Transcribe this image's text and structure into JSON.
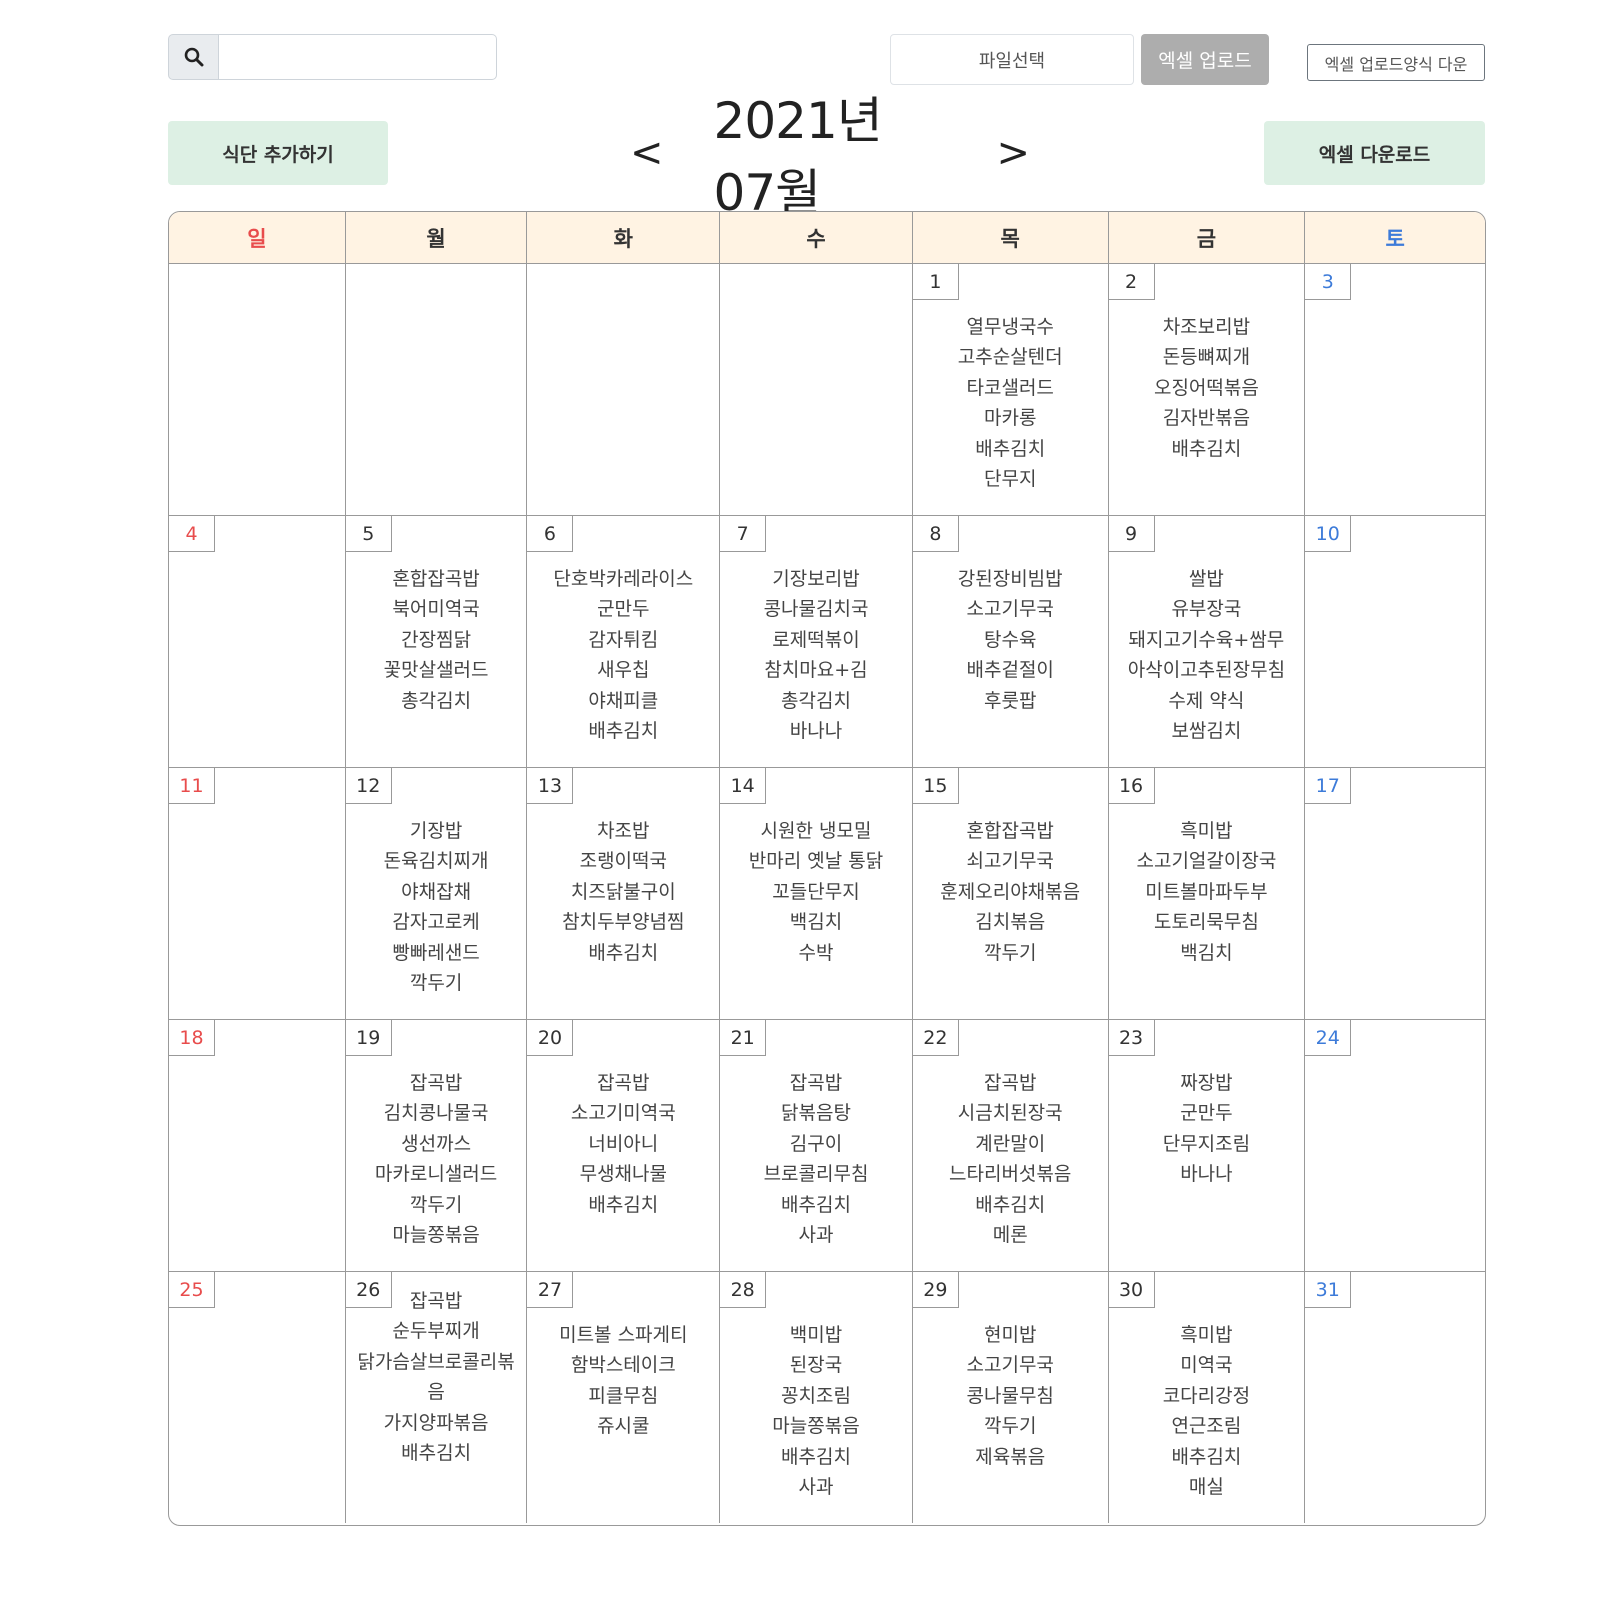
{
  "toolbar": {
    "search": {
      "icon": "search-icon",
      "value": "",
      "placeholder": ""
    },
    "file_select_label": "파일선택",
    "upload_label": "엑셀 업로드",
    "template_label": "엑셀 업로드양식 다운"
  },
  "header": {
    "add_meal_label": "식단 추가하기",
    "prev_label": "<",
    "month_title": "2021년 07월",
    "next_label": ">",
    "excel_download_label": "엑셀 다운로드"
  },
  "colors": {
    "header_bg": "#fff3e3",
    "button_bg": "#ddf0e4",
    "sunday": "#e84c4c",
    "saturday": "#3d7bd9",
    "upload_bg": "#adadad"
  },
  "weekdays": [
    "일",
    "월",
    "화",
    "수",
    "목",
    "금",
    "토"
  ],
  "weeks": [
    [
      {
        "day": "",
        "menu": []
      },
      {
        "day": "",
        "menu": []
      },
      {
        "day": "",
        "menu": []
      },
      {
        "day": "",
        "menu": []
      },
      {
        "day": "1",
        "menu": [
          "열무냉국수",
          "고추순살텐더",
          "타코샐러드",
          "마카롱",
          "배추김치",
          "단무지"
        ]
      },
      {
        "day": "2",
        "menu": [
          "차조보리밥",
          "돈등뼈찌개",
          "오징어떡볶음",
          "김자반볶음",
          "배추김치"
        ]
      },
      {
        "day": "3",
        "menu": []
      }
    ],
    [
      {
        "day": "4",
        "menu": []
      },
      {
        "day": "5",
        "menu": [
          "혼합잡곡밥",
          "북어미역국",
          "간장찜닭",
          "꽃맛살샐러드",
          "총각김치"
        ]
      },
      {
        "day": "6",
        "menu": [
          "단호박카레라이스",
          "군만두",
          "감자튀킴",
          "새우칩",
          "야채피클",
          "배추김치"
        ]
      },
      {
        "day": "7",
        "menu": [
          "기장보리밥",
          "콩나물김치국",
          "로제떡볶이",
          "참치마요+김",
          "총각김치",
          "바나나"
        ]
      },
      {
        "day": "8",
        "menu": [
          "강된장비빔밥",
          "소고기무국",
          "탕수육",
          "배추겉절이",
          "후룻팝"
        ]
      },
      {
        "day": "9",
        "menu": [
          "쌀밥",
          "유부장국",
          "돼지고기수육+쌈무",
          "아삭이고추된장무침",
          "수제 약식",
          "보쌈김치"
        ]
      },
      {
        "day": "10",
        "menu": []
      }
    ],
    [
      {
        "day": "11",
        "menu": []
      },
      {
        "day": "12",
        "menu": [
          "기장밥",
          "돈육김치찌개",
          "야채잡채",
          "감자고로케",
          "빵빠레샌드",
          "깍두기"
        ]
      },
      {
        "day": "13",
        "menu": [
          "차조밥",
          "조랭이떡국",
          "치즈닭불구이",
          "참치두부양념찜",
          "배추김치"
        ]
      },
      {
        "day": "14",
        "menu": [
          "시원한 냉모밀",
          "반마리 옛날 통닭",
          "꼬들단무지",
          "백김치",
          "수박"
        ]
      },
      {
        "day": "15",
        "menu": [
          "혼합잡곡밥",
          "쇠고기무국",
          "훈제오리야채볶음",
          "김치볶음",
          "깍두기"
        ]
      },
      {
        "day": "16",
        "menu": [
          "흑미밥",
          "소고기얼갈이장국",
          "미트볼마파두부",
          "도토리묵무침",
          "백김치"
        ]
      },
      {
        "day": "17",
        "menu": []
      }
    ],
    [
      {
        "day": "18",
        "menu": []
      },
      {
        "day": "19",
        "menu": [
          "잡곡밥",
          "김치콩나물국",
          "생선까스",
          "마카로니샐러드",
          "깍두기",
          "마늘쫑볶음"
        ]
      },
      {
        "day": "20",
        "menu": [
          "잡곡밥",
          "소고기미역국",
          "너비아니",
          "무생채나물",
          "배추김치"
        ]
      },
      {
        "day": "21",
        "menu": [
          "잡곡밥",
          "닭볶음탕",
          "김구이",
          "브로콜리무침",
          "배추김치",
          "사과"
        ]
      },
      {
        "day": "22",
        "menu": [
          "잡곡밥",
          "시금치된장국",
          "계란말이",
          "느타리버섯볶음",
          "배추김치",
          "메론"
        ]
      },
      {
        "day": "23",
        "menu": [
          "짜장밥",
          "군만두",
          "단무지조림",
          "바나나"
        ]
      },
      {
        "day": "24",
        "menu": []
      }
    ],
    [
      {
        "day": "25",
        "menu": []
      },
      {
        "day": "26",
        "menu": [
          "잡곡밥",
          "순두부찌개",
          "닭가슴살브로콜리볶음",
          "가지양파볶음",
          "배추김치"
        ]
      },
      {
        "day": "27",
        "menu": [
          "미트볼 스파게티",
          "함박스테이크",
          "피클무침",
          "쥬시쿨"
        ]
      },
      {
        "day": "28",
        "menu": [
          "백미밥",
          "된장국",
          "꽁치조림",
          "마늘쫑볶음",
          "배추김치",
          "사과"
        ]
      },
      {
        "day": "29",
        "menu": [
          "현미밥",
          "소고기무국",
          "콩나물무침",
          "깍두기",
          "제육볶음"
        ]
      },
      {
        "day": "30",
        "menu": [
          "흑미밥",
          "미역국",
          "코다리강정",
          "연근조림",
          "배추김치",
          "매실"
        ]
      },
      {
        "day": "31",
        "menu": []
      }
    ]
  ]
}
